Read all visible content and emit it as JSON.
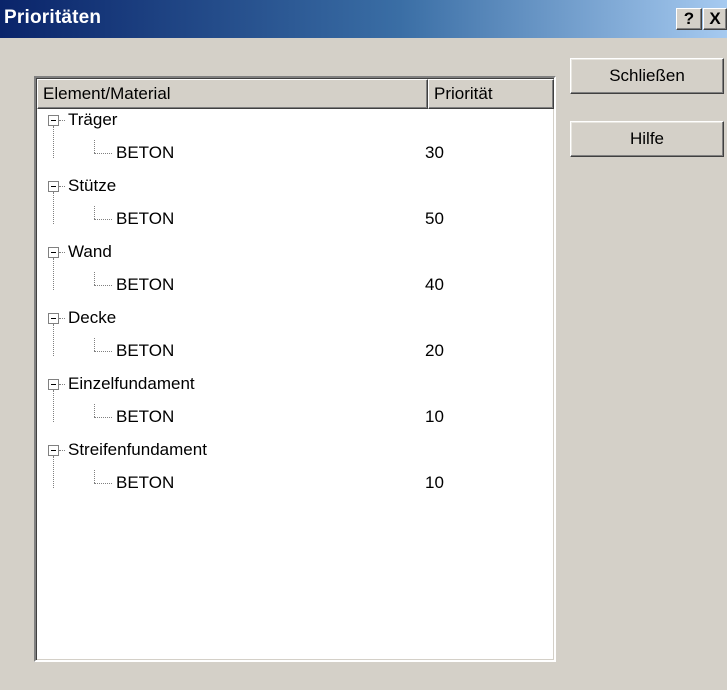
{
  "window": {
    "title": "Prioritäten",
    "help_glyph": "?",
    "close_glyph": "X"
  },
  "list": {
    "columns": [
      "Element/Material",
      "Priorität"
    ],
    "groups": [
      {
        "element": "Träger",
        "material": "BETON",
        "priority": "30"
      },
      {
        "element": "Stütze",
        "material": "BETON",
        "priority": "50"
      },
      {
        "element": "Wand",
        "material": "BETON",
        "priority": "40"
      },
      {
        "element": "Decke",
        "material": "BETON",
        "priority": "20"
      },
      {
        "element": "Einzelfundament",
        "material": "BETON",
        "priority": "10"
      },
      {
        "element": "Streifenfundament",
        "material": "BETON",
        "priority": "10"
      }
    ]
  },
  "buttons": {
    "close_label": "Schließen",
    "help_label": "Hilfe"
  },
  "icons": {
    "expander": "minus-box-icon",
    "help": "question-mark-icon",
    "close": "close-x-icon"
  },
  "colors": {
    "title_start": "#0a246a",
    "title_end": "#a6caf0",
    "face": "#d4d0c8",
    "list_bg": "#ffffff"
  }
}
